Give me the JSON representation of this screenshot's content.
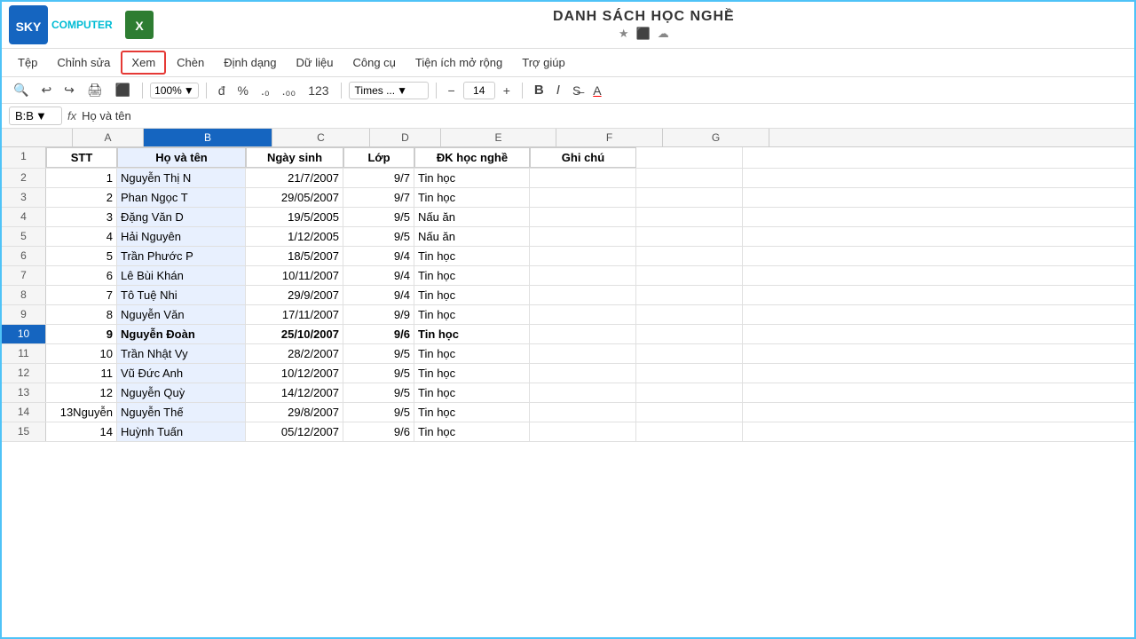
{
  "app": {
    "logo_text": "SKY",
    "logo_sub": "COMPUTER",
    "app_icon": "■",
    "doc_title": "DANH SÁCH HỌC NGHỀ",
    "title_icons": [
      "★",
      "⬛",
      "☁"
    ]
  },
  "menu": {
    "items": [
      "Tệp",
      "Chỉnh sửa",
      "Xem",
      "Chèn",
      "Định dạng",
      "Dữ liệu",
      "Công cụ",
      "Tiện ích mở rộng",
      "Trợ giúp"
    ]
  },
  "toolbar": {
    "zoom": "100%",
    "font": "Times ...",
    "font_size": "14",
    "icons": [
      "🔍",
      "↩",
      "↪",
      "🖨",
      "⬛",
      "100%",
      "đ",
      "%",
      ".0",
      ".00",
      "123"
    ]
  },
  "formula_bar": {
    "cell_ref": "B:B",
    "formula": "Họ và tên"
  },
  "columns": {
    "letters": [
      "A",
      "B",
      "C",
      "D",
      "E",
      "F",
      "G"
    ],
    "selected": "B"
  },
  "headers": {
    "stt": "STT",
    "ho_ten": "Họ và tên",
    "ngay_sinh": "Ngày sinh",
    "lop": "Lớp",
    "dk_hoc_nghe": "ĐK học nghề",
    "ghi_chu": "Ghi chú"
  },
  "rows": [
    {
      "num": 2,
      "stt": 1,
      "ho_ten": "Nguyễn Thị N",
      "ngay_sinh": "21/7/2007",
      "lop": "9/7",
      "dk_hoc_nghe": "Tin học",
      "ghi_chu": ""
    },
    {
      "num": 3,
      "stt": 2,
      "ho_ten": "Phan Ngọc T",
      "ngay_sinh": "29/05/2007",
      "lop": "9/7",
      "dk_hoc_nghe": "Tin học",
      "ghi_chu": ""
    },
    {
      "num": 4,
      "stt": 3,
      "ho_ten": "Đặng Văn D",
      "ngay_sinh": "19/5/2005",
      "lop": "9/5",
      "dk_hoc_nghe": "Nấu ăn",
      "ghi_chu": ""
    },
    {
      "num": 5,
      "stt": 4,
      "ho_ten": "Hải Nguyên",
      "ngay_sinh": "1/12/2005",
      "lop": "9/5",
      "dk_hoc_nghe": "Nấu ăn",
      "ghi_chu": ""
    },
    {
      "num": 6,
      "stt": 5,
      "ho_ten": "Trần Phước P",
      "ngay_sinh": "18/5/2007",
      "lop": "9/4",
      "dk_hoc_nghe": "Tin học",
      "ghi_chu": ""
    },
    {
      "num": 7,
      "stt": 6,
      "ho_ten": "Lê Bùi Khán",
      "ngay_sinh": "10/11/2007",
      "lop": "9/4",
      "dk_hoc_nghe": "Tin học",
      "ghi_chu": ""
    },
    {
      "num": 8,
      "stt": 7,
      "ho_ten": "Tô Tuệ Nhi",
      "ngay_sinh": "29/9/2007",
      "lop": "9/4",
      "dk_hoc_nghe": "Tin học",
      "ghi_chu": ""
    },
    {
      "num": 9,
      "stt": 8,
      "ho_ten": "Nguyễn Văn",
      "ngay_sinh": "17/11/2007",
      "lop": "9/9",
      "dk_hoc_nghe": "Tin học",
      "ghi_chu": ""
    },
    {
      "num": 10,
      "stt": 9,
      "ho_ten": "Nguyễn Đoàn",
      "ngay_sinh": "25/10/2007",
      "lop": "9/6",
      "dk_hoc_nghe": "Tin học",
      "ghi_chu": "",
      "bold": true
    },
    {
      "num": 11,
      "stt": 10,
      "ho_ten": "Trần Nhật Vy",
      "ngay_sinh": "28/2/2007",
      "lop": "9/5",
      "dk_hoc_nghe": "Tin học",
      "ghi_chu": ""
    },
    {
      "num": 12,
      "stt": 11,
      "ho_ten": "Vũ Đức Anh",
      "ngay_sinh": "10/12/2007",
      "lop": "9/5",
      "dk_hoc_nghe": "Tin học",
      "ghi_chu": ""
    },
    {
      "num": 13,
      "stt": 12,
      "ho_ten": "Nguyễn Quỳ",
      "ngay_sinh": "14/12/2007",
      "lop": "9/5",
      "dk_hoc_nghe": "Tin học",
      "ghi_chu": ""
    },
    {
      "num": 14,
      "stt": "13Nguyễn",
      "ho_ten": "Nguyễn Thế",
      "ngay_sinh": "29/8/2007",
      "lop": "9/5",
      "dk_hoc_nghe": "Tin học",
      "ghi_chu": ""
    },
    {
      "num": 15,
      "stt": 14,
      "ho_ten": "Huỳnh Tuấn",
      "ngay_sinh": "05/12/2007",
      "lop": "9/6",
      "dk_hoc_nghe": "Tin học",
      "ghi_chu": ""
    }
  ]
}
